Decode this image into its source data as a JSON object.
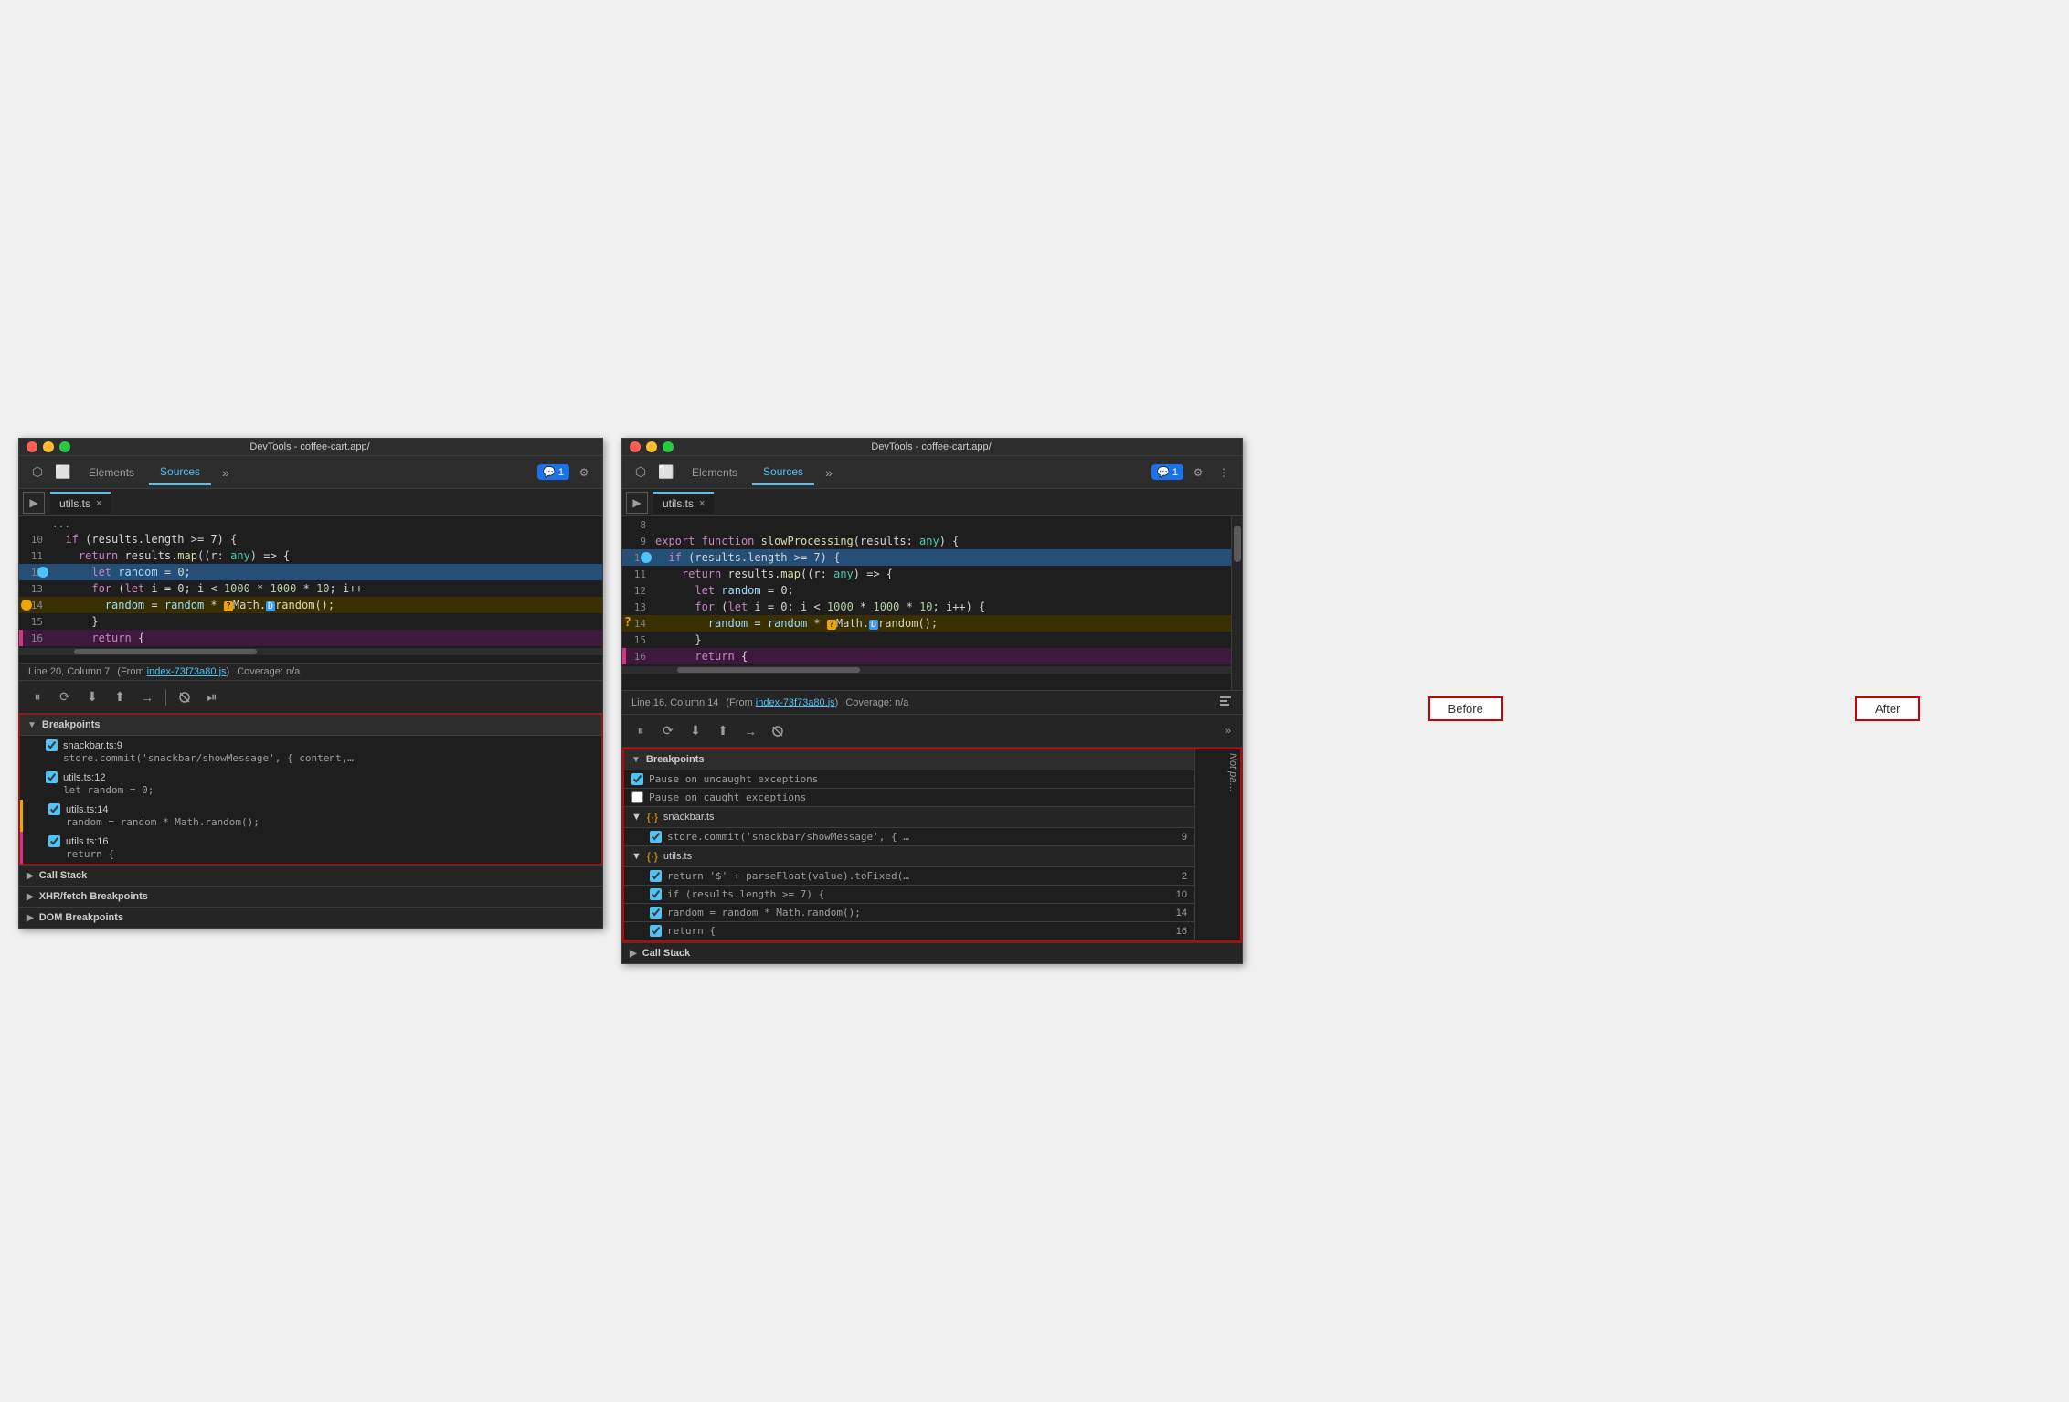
{
  "layout": {
    "title": "DevTools - coffee-cart.app/",
    "label_before": "Before",
    "label_after": "After"
  },
  "left_panel": {
    "title": "DevTools - coffee-cart.app/",
    "nav": {
      "tabs": [
        "Elements",
        "Sources"
      ],
      "active_tab": "Sources",
      "more_icon": "»",
      "badge_count": "1",
      "badge_icon": "💬"
    },
    "file_tab": {
      "name": "utils.ts",
      "close": "×"
    },
    "code": {
      "lines": [
        {
          "num": "10",
          "content": "  if (results.length >= 7) {",
          "highlight": "none"
        },
        {
          "num": "11",
          "content": "    return results.map((r: any) => {",
          "highlight": "none"
        },
        {
          "num": "12",
          "content": "      let random = 0;",
          "highlight": "blue"
        },
        {
          "num": "13",
          "content": "      for (let i = 0; i < 1000 * 1000 * 10; i++",
          "highlight": "none"
        },
        {
          "num": "14",
          "content": "        random = random * ❓Math.█random();",
          "highlight": "yellow"
        },
        {
          "num": "15",
          "content": "      }",
          "highlight": "none"
        },
        {
          "num": "16",
          "content": "      return {",
          "highlight": "pink"
        }
      ]
    },
    "status_bar": {
      "position": "Line 20, Column 7",
      "from_text": "(From",
      "from_link": "index-73f73a80.js",
      "coverage": "Coverage: n/a"
    },
    "debug_toolbar": {
      "buttons": [
        "⏸",
        "⟳",
        "⬇",
        "⬆",
        "➡",
        "✏️",
        "⏯"
      ]
    },
    "breakpoints_section": {
      "title": "Breakpoints",
      "items": [
        {
          "name": "snackbar.ts:9",
          "code": "store.commit('snackbar/showMessage', { content,…",
          "checked": true
        },
        {
          "name": "utils.ts:12",
          "code": "let random = 0;",
          "checked": true
        },
        {
          "name": "utils.ts:14",
          "code": "random = random * Math.random();",
          "checked": true
        },
        {
          "name": "utils.ts:16",
          "code": "return {",
          "checked": true
        }
      ]
    },
    "call_stack_section": {
      "title": "Call Stack",
      "collapsed": true
    },
    "xhr_section": {
      "title": "XHR/fetch Breakpoints",
      "collapsed": true
    },
    "dom_section": {
      "title": "DOM Breakpoints",
      "collapsed": true
    }
  },
  "right_panel": {
    "title": "DevTools - coffee-cart.app/",
    "nav": {
      "tabs": [
        "Elements",
        "Sources"
      ],
      "active_tab": "Sources",
      "more_icon": "»",
      "badge_count": "1",
      "badge_icon": "💬"
    },
    "file_tab": {
      "name": "utils.ts",
      "close": "×"
    },
    "code": {
      "lines": [
        {
          "num": "8",
          "content": "",
          "highlight": "none"
        },
        {
          "num": "9",
          "content": "export function slowProcessing(results: any) {",
          "highlight": "none"
        },
        {
          "num": "10",
          "content": "  if (results.length >= 7) {",
          "highlight": "blue"
        },
        {
          "num": "11",
          "content": "    return results.map((r: any) => {",
          "highlight": "none"
        },
        {
          "num": "12",
          "content": "      let random = 0;",
          "highlight": "none"
        },
        {
          "num": "13",
          "content": "      for (let i = 0; i < 1000 * 1000 * 10; i++) {",
          "highlight": "none"
        },
        {
          "num": "14",
          "content": "        random = random * ❓Math.█random();",
          "highlight": "yellow"
        },
        {
          "num": "15",
          "content": "      }",
          "highlight": "none"
        },
        {
          "num": "16",
          "content": "      return {",
          "highlight": "pink"
        }
      ]
    },
    "status_bar": {
      "position": "Line 16, Column 14",
      "from_text": "(From",
      "from_link": "index-73f73a80.js",
      "coverage": "Coverage: n/a"
    },
    "debug_toolbar": {
      "buttons": [
        "⏸",
        "⟳",
        "⬇",
        "⬆",
        "➡",
        "🚫"
      ]
    },
    "breakpoints_section": {
      "title": "Breakpoints",
      "global_items": [
        {
          "label": "Pause on uncaught exceptions",
          "checked": true
        },
        {
          "label": "Pause on caught exceptions",
          "checked": false
        }
      ],
      "file_groups": [
        {
          "filename": "snackbar.ts",
          "items": [
            {
              "code": "store.commit('snackbar/showMessage', { …",
              "line": "9",
              "checked": true
            }
          ]
        },
        {
          "filename": "utils.ts",
          "items": [
            {
              "code": "return '$' + parseFloat(value).toFixed(…",
              "line": "2",
              "checked": true
            },
            {
              "code": "if (results.length >= 7) {",
              "line": "10",
              "checked": true
            },
            {
              "code": "random = random * Math.random();",
              "line": "14",
              "checked": true
            },
            {
              "code": "return {",
              "line": "16",
              "checked": true
            }
          ]
        }
      ]
    },
    "call_stack_section": {
      "title": "Call Stack",
      "collapsed": true
    },
    "not_paused_text": "Not pa…"
  }
}
